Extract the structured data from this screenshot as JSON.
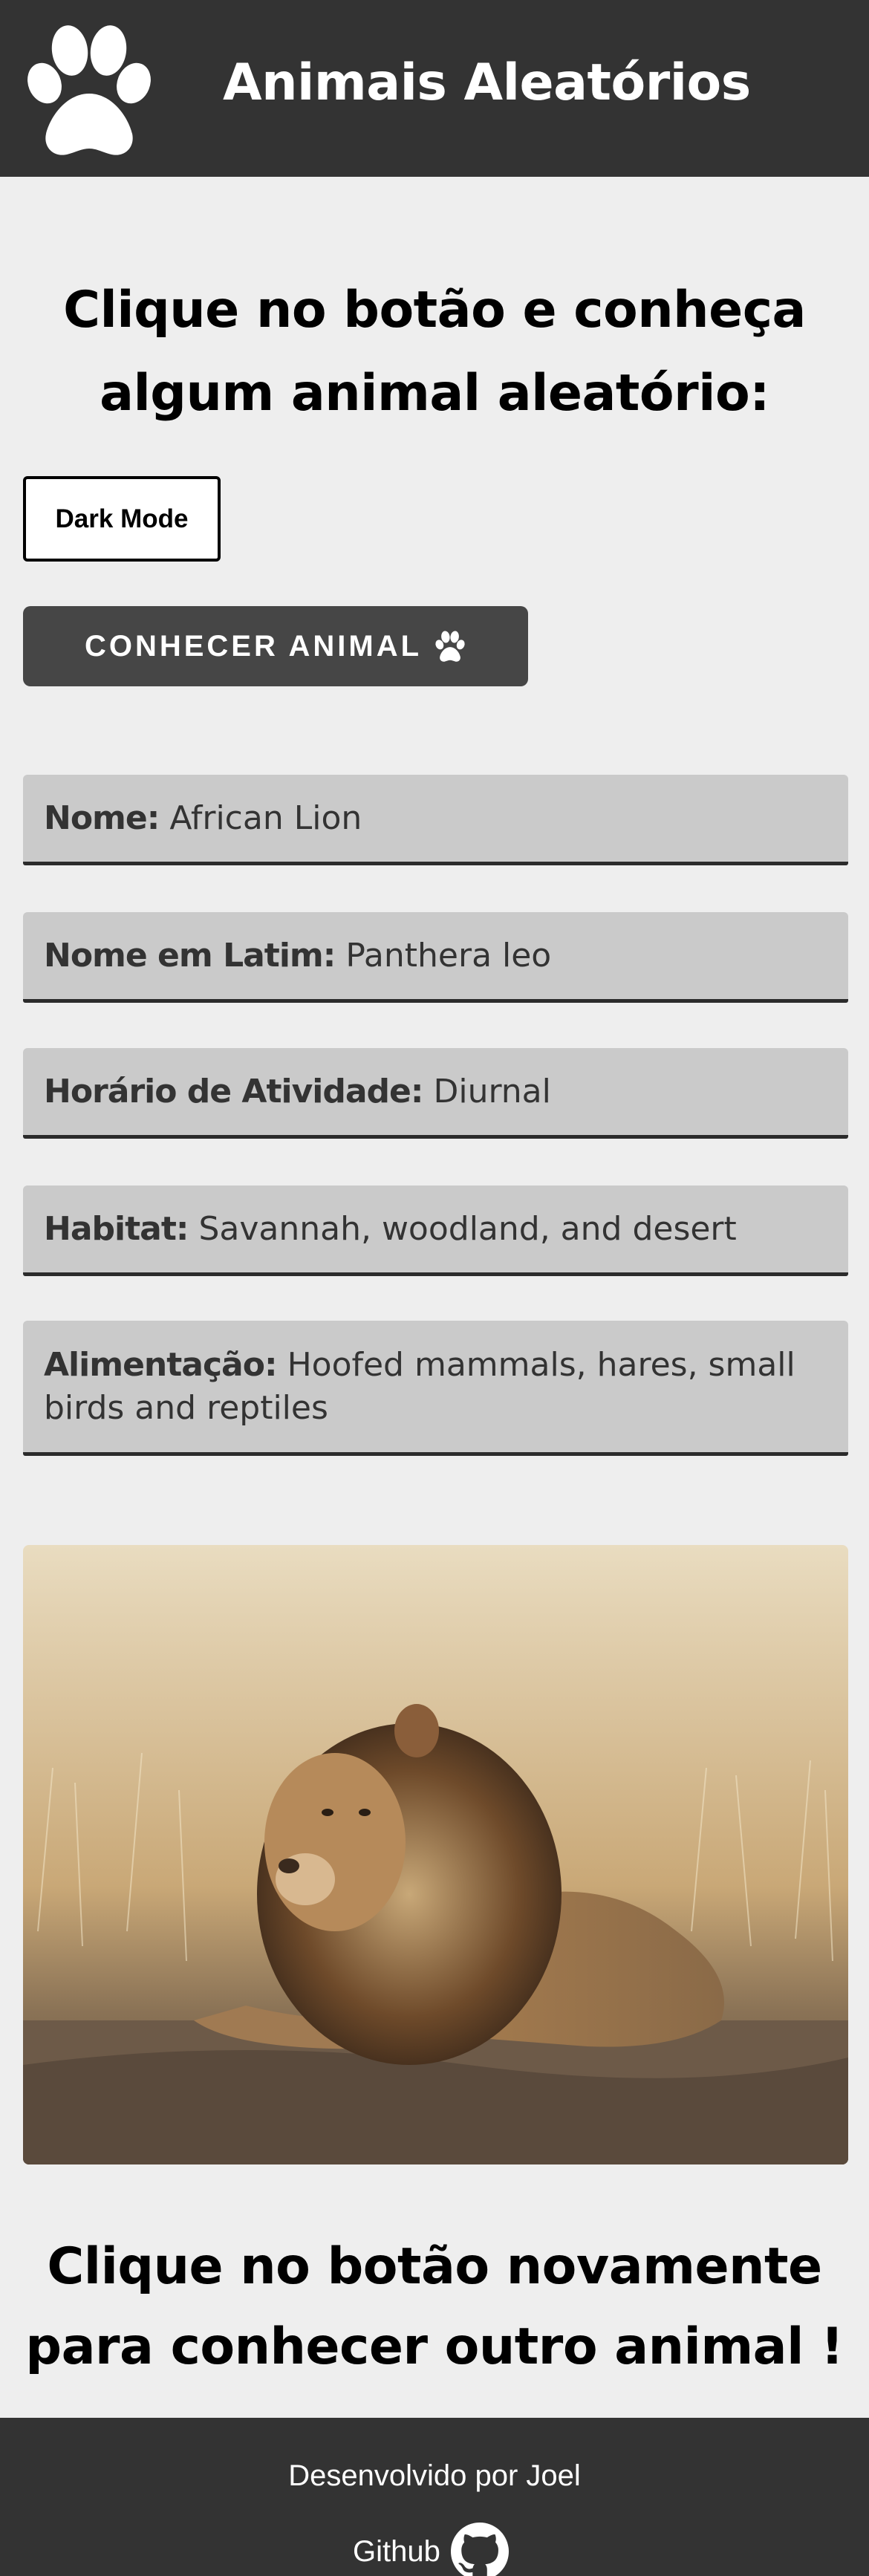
{
  "header": {
    "title": "Animais Aleatórios",
    "logo_icon": "paw-icon"
  },
  "main": {
    "headline": "Clique no botão e conheça algum animal aleatório:",
    "dark_mode_label": "Dark Mode",
    "meet_button_label": "CONHECER ANIMAL",
    "meet_button_icon": "paw-icon",
    "info": [
      {
        "label": "Nome:",
        "value": "African Lion"
      },
      {
        "label": "Nome em Latim:",
        "value": "Panthera leo"
      },
      {
        "label": "Horário de Atividade:",
        "value": "Diurnal"
      },
      {
        "label": "Habitat:",
        "value": "Savannah, woodland, and desert"
      },
      {
        "label": "Alimentação:",
        "value": "Hoofed mammals, hares, small birds and reptiles"
      }
    ],
    "photo_alt": "lion",
    "closing": "Clique no botão novamente para conhecer outro animal !"
  },
  "footer": {
    "credit": "Desenvolvido por Joel",
    "github_label": "Github",
    "github_icon": "github-icon"
  },
  "colors": {
    "header_bg": "#333333",
    "page_bg": "#eeeeee",
    "card_bg": "#cacaca",
    "button_bg": "#464646"
  }
}
